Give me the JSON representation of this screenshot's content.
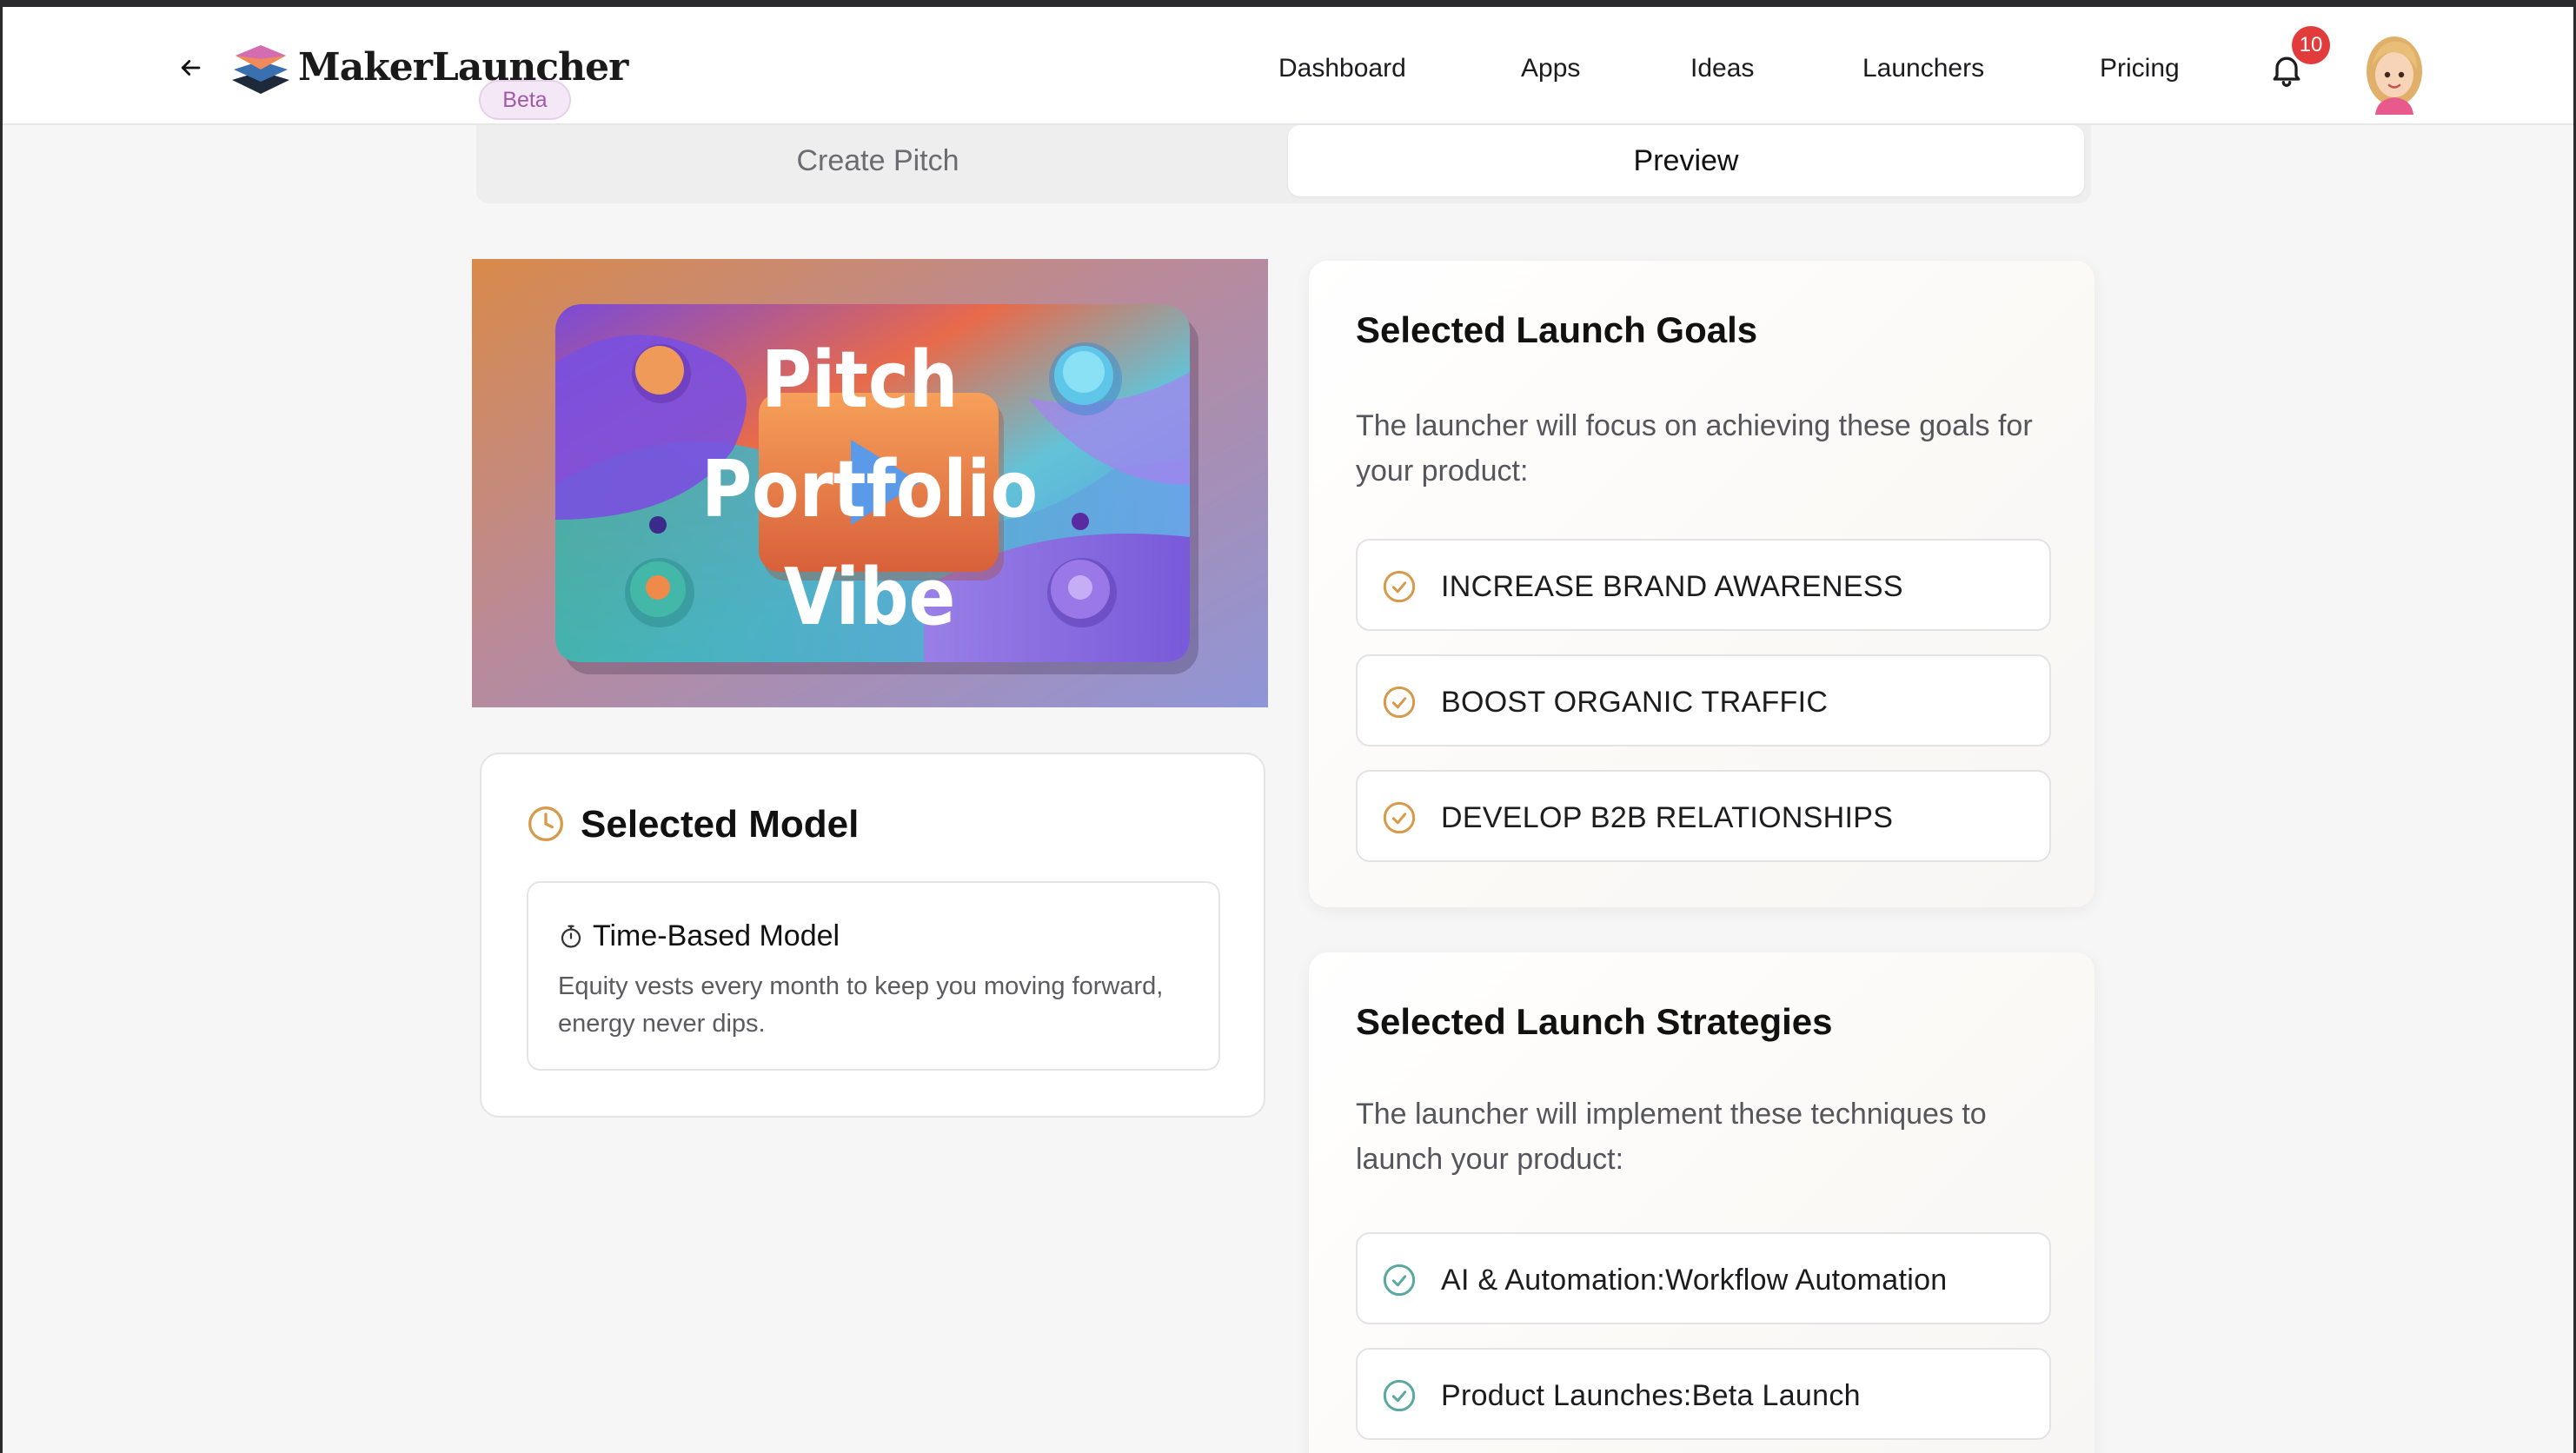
{
  "header": {
    "brand": "MakerLauncher",
    "badge": "Beta",
    "nav": [
      "Dashboard",
      "Apps",
      "Ideas",
      "Launchers",
      "Pricing"
    ],
    "notification_count": "10"
  },
  "tabs": {
    "create": "Create Pitch",
    "preview": "Preview",
    "active": "Preview"
  },
  "hero": {
    "line1": "Pitch",
    "line2": "Portfolio",
    "line3": "Vibe"
  },
  "model": {
    "title": "Selected Model",
    "name": "Time-Based Model",
    "description": "Equity vests every month to keep you moving forward, energy never dips."
  },
  "goals": {
    "title": "Selected Launch Goals",
    "description": "The launcher will focus on achieving these goals for your product:",
    "items": [
      "INCREASE BRAND AWARENESS",
      "BOOST ORGANIC TRAFFIC",
      "DEVELOP B2B RELATIONSHIPS"
    ]
  },
  "strategies": {
    "title": "Selected Launch Strategies",
    "description": "The launcher will implement these techniques to launch your product:",
    "items": [
      "AI & Automation:Workflow Automation",
      "Product Launches:Beta Launch"
    ]
  },
  "colors": {
    "goal_check": "#d79a4a",
    "strategy_check": "#5aa9a0",
    "notification": "#e23b3b",
    "beta_text": "#a05aa8"
  }
}
